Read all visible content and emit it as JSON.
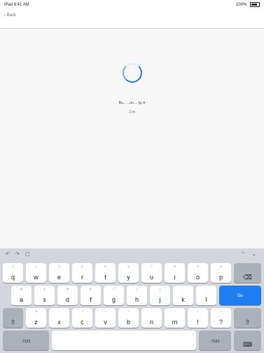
{
  "status_bar": {
    "left_text": "iPad  9:41 AM",
    "right_text": "100%"
  },
  "nav": {
    "back_label": "‹ Back"
  },
  "content": {
    "message": "Bu... ...ou ...   lg..h",
    "link": "Z.m"
  },
  "keyboard": {
    "toolbar": {
      "undo": "↶",
      "redo": "↷",
      "paste": "▢",
      "up": "⌃",
      "down": "⌄"
    },
    "row1": [
      {
        "hint": "1",
        "key": "q"
      },
      {
        "hint": "2",
        "key": "w"
      },
      {
        "hint": "3",
        "key": "e"
      },
      {
        "hint": "4",
        "key": "r"
      },
      {
        "hint": "5",
        "key": "t"
      },
      {
        "hint": "6",
        "key": "y"
      },
      {
        "hint": "7",
        "key": "u"
      },
      {
        "hint": "8",
        "key": "i"
      },
      {
        "hint": "9",
        "key": "o"
      },
      {
        "hint": "0",
        "key": "p"
      }
    ],
    "delete": "⌫",
    "row2": [
      {
        "hint": "@",
        "key": "a"
      },
      {
        "hint": "#",
        "key": "s"
      },
      {
        "hint": "$",
        "key": "d"
      },
      {
        "hint": "&",
        "key": "f"
      },
      {
        "hint": "*",
        "key": "g"
      },
      {
        "hint": "(",
        "key": "h"
      },
      {
        "hint": ")",
        "key": "j"
      },
      {
        "hint": "'",
        "key": "k"
      },
      {
        "hint": "\"",
        "key": "l"
      }
    ],
    "go": "Go",
    "shift_left": "⇧",
    "row3": [
      {
        "hint": "%",
        "key": "z"
      },
      {
        "hint": "-",
        "key": "x"
      },
      {
        "hint": "+",
        "key": "c"
      },
      {
        "hint": "=",
        "key": "v"
      },
      {
        "hint": "/",
        "key": "b"
      },
      {
        "hint": ";",
        "key": "n"
      },
      {
        "hint": ":",
        "key": "m"
      },
      {
        "hint": "!",
        "key": "!"
      },
      {
        "hint": "?",
        "key": "?"
      }
    ],
    "shift_right": "⇧",
    "numbers_left": ".?123",
    "numbers_right": ".?123",
    "dismiss": "⌨"
  }
}
